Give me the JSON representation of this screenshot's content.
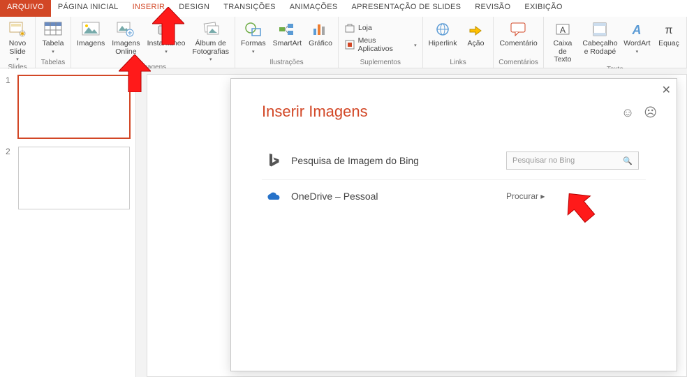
{
  "tabs": {
    "file": "ARQUIVO",
    "home": "PÁGINA INICIAL",
    "insert": "INSERIR",
    "design": "DESIGN",
    "transitions": "TRANSIÇÕES",
    "animations": "ANIMAÇÕES",
    "slideshow": "APRESENTAÇÃO DE SLIDES",
    "review": "REVISÃO",
    "view": "EXIBIÇÃO"
  },
  "ribbon": {
    "groups": {
      "slides": "Slides",
      "tables": "Tabelas",
      "images": "Imagens",
      "illustrations": "Ilustrações",
      "addins": "Suplementos",
      "links": "Links",
      "comments": "Comentários",
      "text": "Texto"
    },
    "btns": {
      "new_slide": "Novo\nSlide",
      "table": "Tabela",
      "images": "Imagens",
      "images_online": "Imagens\nOnline",
      "screenshot": "Instantâneo",
      "photo_album": "Álbum de\nFotografias",
      "shapes": "Formas",
      "smartart": "SmartArt",
      "chart": "Gráfico",
      "store": "Loja",
      "my_addins": "Meus Aplicativos",
      "hyperlink": "Hiperlink",
      "action": "Ação",
      "comment": "Comentário",
      "textbox": "Caixa\nde Texto",
      "header_footer": "Cabeçalho\ne Rodapé",
      "wordart": "WordArt",
      "equation": "Equaç"
    }
  },
  "slides": {
    "s1": "1",
    "s2": "2"
  },
  "dialog": {
    "title": "Inserir Imagens",
    "bing_label": "Pesquisa de Imagem do Bing",
    "bing_placeholder": "Pesquisar no Bing",
    "onedrive_label": "OneDrive – Pessoal",
    "browse": "Procurar ▸"
  }
}
